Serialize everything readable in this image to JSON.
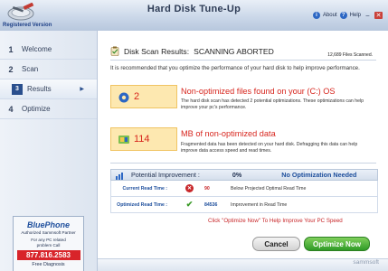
{
  "app": {
    "title": "Hard Disk Tune-Up",
    "registration": "Registered Version",
    "about": "About",
    "help": "Help",
    "brand": "sammsoft"
  },
  "sidebar": {
    "items": [
      {
        "num": "1",
        "label": "Welcome"
      },
      {
        "num": "2",
        "label": "Scan"
      },
      {
        "num": "3",
        "label": "Results"
      },
      {
        "num": "4",
        "label": "Optimize"
      }
    ],
    "partner": {
      "logo": "BluePhone",
      "subtitle": "Authorized Sammsoft Partner",
      "line1": "For any PC related",
      "line2": "problem Call",
      "phone": "877.816.2583",
      "diagnosis": "Free Diagnosis"
    }
  },
  "main": {
    "header_prefix": "Disk Scan Results:",
    "header_status": "SCANNING ABORTED",
    "files_scanned": "12,689 Files Scanned.",
    "intro": "It is recommended that you optimize the performance of your hard disk to help improve performance.",
    "cards": [
      {
        "value": "2",
        "title": "Non-optimized files found on your (C:) OS",
        "desc": "The hard disk scan has detected 2 potential optimizations. These optimizations can help improve your pc's performance."
      },
      {
        "value": "114",
        "title": "MB of non-optimized data",
        "desc": "Fragmented data has been detected on your hard disk. Defragging this data can help improve data access speed and read times."
      }
    ],
    "improvement": {
      "label": "Potential Improvement :",
      "percent": "0%",
      "status": "No Optimization Needed",
      "rows": [
        {
          "label": "Current Read Time :",
          "value": "90",
          "desc": "Below Projected Optimal Read Time"
        },
        {
          "label": "Optimized Read Time :",
          "value": "84536",
          "desc": "Improvement in Read Time"
        }
      ]
    },
    "hint": "Click \"Optimize Now\" To Help Improve Your PC Speed",
    "cancel": "Cancel",
    "optimize": "Optimize Now"
  }
}
